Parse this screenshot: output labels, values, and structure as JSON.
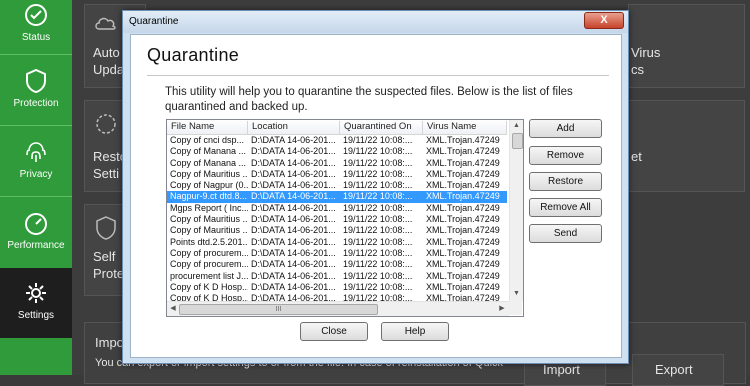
{
  "sidebar": {
    "items": [
      {
        "label": "Status",
        "icon": "check-circle-icon"
      },
      {
        "label": "Protection",
        "icon": "shield-icon"
      },
      {
        "label": "Privacy",
        "icon": "fingerprint-icon"
      },
      {
        "label": "Performance",
        "icon": "speedometer-icon"
      },
      {
        "label": "Settings",
        "icon": "gear-icon"
      }
    ],
    "active": "Settings"
  },
  "background": {
    "card_auto_update": "Auto",
    "card_auto_update_line2": "Upda",
    "card_restore": "Resto",
    "card_restore_line2": "Setti",
    "card_self_protect": "Self",
    "card_self_protect_line2": "Prote",
    "card_virus": "Virus",
    "card_virus_line2": "cs",
    "card_et": "et",
    "card_import_title": "Impo",
    "card_import_desc": "You can export or import settings to or from the file. In case of reinstallation of Quick",
    "import_button": "Import",
    "export_button": "Export"
  },
  "dialog": {
    "title": "Quarantine",
    "close_label": "X",
    "heading": "Quarantine",
    "description": "This utility will help you to quarantine the suspected files. Below is the list of files quarantined and backed up.",
    "columns": [
      "File Name",
      "Location",
      "Quarantined On",
      "Virus Name"
    ],
    "rows": [
      [
        "Copy of cnci dsp...",
        "D:\\DATA 14-06-201...",
        "19/11/22 10:08:...",
        "XML.Trojan.47249"
      ],
      [
        "Copy of Manana ...",
        "D:\\DATA 14-06-201...",
        "19/11/22 10:08:...",
        "XML.Trojan.47249"
      ],
      [
        "Copy of Manana ...",
        "D:\\DATA 14-06-201...",
        "19/11/22 10:08:...",
        "XML.Trojan.47249"
      ],
      [
        "Copy of Mauritius ...",
        "D:\\DATA 14-06-201...",
        "19/11/22 10:08:...",
        "XML.Trojan.47249"
      ],
      [
        "Copy of Nagpur (0...",
        "D:\\DATA 14-06-201...",
        "19/11/22 10:08:...",
        "XML.Trojan.47249"
      ],
      [
        "Nagpur-9.ct dtd.8...",
        "D:\\DATA 14-06-201...",
        "19/11/22 10:08:...",
        "XML.Trojan.47249"
      ],
      [
        "Mgps Report ( Inc...",
        "D:\\DATA 14-06-201...",
        "19/11/22 10:08:...",
        "XML.Trojan.47249"
      ],
      [
        "Copy of Mauritius ...",
        "D:\\DATA 14-06-201...",
        "19/11/22 10:08:...",
        "XML.Trojan.47249"
      ],
      [
        "Copy of Mauritius ...",
        "D:\\DATA 14-06-201...",
        "19/11/22 10:08:...",
        "XML.Trojan.47249"
      ],
      [
        "Points dtd.2.5.201...",
        "D:\\DATA 14-06-201...",
        "19/11/22 10:08:...",
        "XML.Trojan.47249"
      ],
      [
        "Copy of procurem...",
        "D:\\DATA 14-06-201...",
        "19/11/22 10:08:...",
        "XML.Trojan.47249"
      ],
      [
        "Copy of procurem...",
        "D:\\DATA 14-06-201...",
        "19/11/22 10:08:...",
        "XML.Trojan.47249"
      ],
      [
        "procurement list J...",
        "D:\\DATA 14-06-201...",
        "19/11/22 10:08:...",
        "XML.Trojan.47249"
      ],
      [
        "Copy of K D Hosp...",
        "D:\\DATA 14-06-201...",
        "19/11/22 10:08:...",
        "XML.Trojan.47249"
      ],
      [
        "Copy of K D Hosp...",
        "D:\\DATA 14-06-201...",
        "19/11/22 10:08:...",
        "XML.Trojan.47249"
      ]
    ],
    "selected_row": 5,
    "scroll_thumb_label": "III",
    "buttons": {
      "add": "Add",
      "remove": "Remove",
      "restore": "Restore",
      "remove_all": "Remove All",
      "send": "Send",
      "close": "Close",
      "help": "Help"
    }
  },
  "colors": {
    "sidebar_green": "#2f9b3a",
    "selection_blue": "#3399ff",
    "dialog_frame": "#cfe0f0"
  }
}
